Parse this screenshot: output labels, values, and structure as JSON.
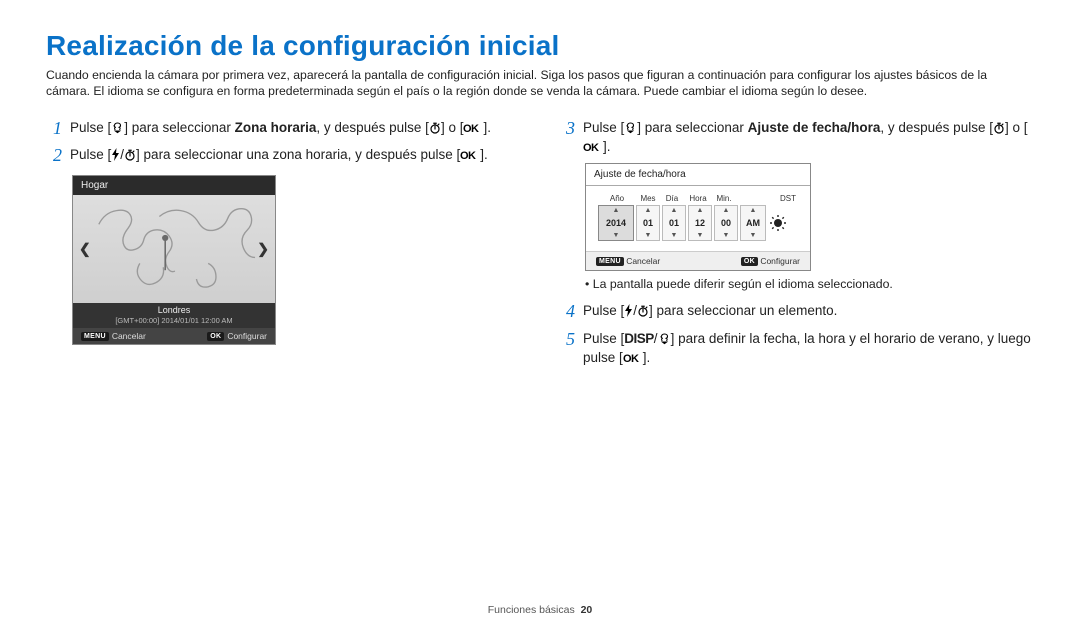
{
  "title": "Realización de la configuración inicial",
  "intro": "Cuando encienda la cámara por primera vez, aparecerá la pantalla de configuración inicial. Siga los pasos que figuran a continuación para configurar los ajustes básicos de la cámara. El idioma se configura en forma predeterminada según el país o la región donde se venda la cámara. Puede cambiar el idioma según lo desee.",
  "steps": {
    "s1a": "Pulse [",
    "s1b": "] para seleccionar ",
    "s1bold": "Zona horaria",
    "s1c": ", y después pulse [",
    "s1d": "] o [",
    "s1e": "].",
    "s2a": "Pulse [",
    "s2b": "/",
    "s2c": "] para seleccionar una zona horaria, y después pulse [",
    "s2d": "].",
    "s3a": "Pulse [",
    "s3b": "] para seleccionar ",
    "s3bold": "Ajuste de fecha/hora",
    "s3c": ", y después pulse [",
    "s3d": "] o [",
    "s3e": "].",
    "s4a": "Pulse [",
    "s4b": "/",
    "s4c": "] para seleccionar un elemento.",
    "s5a": "Pulse [",
    "s5disp": "DISP",
    "s5b": "/",
    "s5c": "] para definir la fecha, la hora y el horario de verano, y luego pulse [",
    "s5d": "]."
  },
  "tz": {
    "header": "Hogar",
    "city": "Londres",
    "gmt": "[GMT+00:00] 2014/01/01 12:00 AM",
    "menu": "MENU",
    "cancel": "Cancelar",
    "ok": "OK",
    "config": "Configurar"
  },
  "dt": {
    "header": "Ajuste de fecha/hora",
    "cols": {
      "year": "Año",
      "mon": "Mes",
      "day": "Día",
      "hour": "Hora",
      "min": "Min.",
      "dst": "DST"
    },
    "vals": {
      "year": "2014",
      "mon": "01",
      "day": "01",
      "hour": "12",
      "min": "00",
      "ampm": "AM"
    },
    "menu": "MENU",
    "cancel": "Cancelar",
    "ok": "OK",
    "config": "Configurar"
  },
  "bullet": "La pantalla puede diferir según el idioma seleccionado.",
  "footer": {
    "section": "Funciones básicas",
    "page": "20"
  }
}
